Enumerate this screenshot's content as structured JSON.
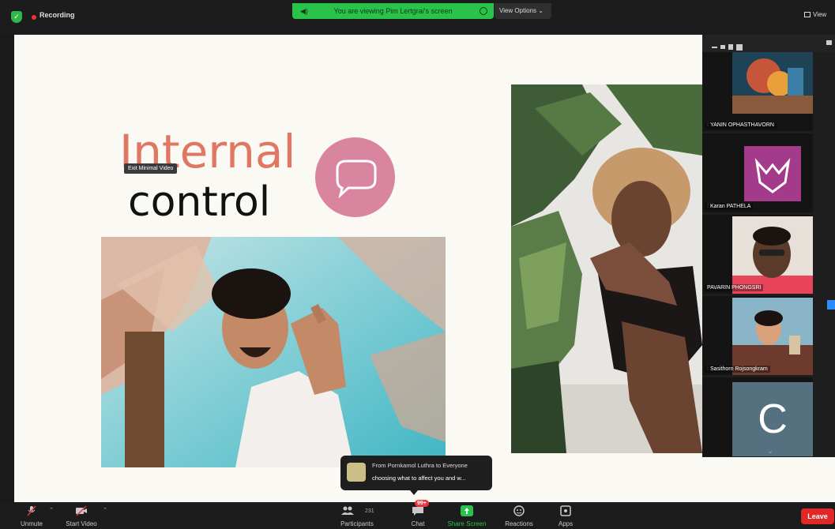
{
  "topbar": {
    "recording_label": "Recording",
    "share_banner": "You are viewing Pim Lertgrai's screen",
    "view_options_label": "View Options",
    "view_label": "View"
  },
  "slide": {
    "title_line1": "Internal",
    "title_line2": "control",
    "tooltip": "Exit Minimal Video",
    "accent_color": "#e07763",
    "bubble_color": "#d9859f"
  },
  "gallery": {
    "participants": [
      {
        "name": "YANIN OPHASTHAVORN",
        "muted": true
      },
      {
        "name": "Karan PATHELA",
        "muted": true
      },
      {
        "name": "PAVARIN PHONGSRI",
        "muted": false
      },
      {
        "name": "Sasithorn Rojsongkram",
        "muted": true
      },
      {
        "name": "",
        "initial": "C",
        "muted": false
      }
    ]
  },
  "chat_toast": {
    "from": "From Pornkamol Luthra to Everyone",
    "message": "choosing what to affect you and w..."
  },
  "toolbar": {
    "unmute": "Unmute",
    "start_video": "Start Video",
    "participants": "Participants",
    "participants_count": "231",
    "chat": "Chat",
    "chat_badge": "99+",
    "share_screen": "Share Screen",
    "reactions": "Reactions",
    "apps": "Apps",
    "leave": "Leave"
  }
}
